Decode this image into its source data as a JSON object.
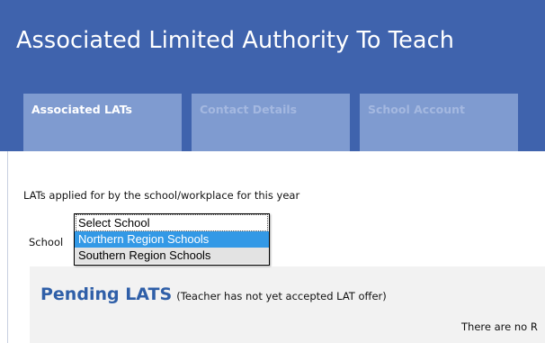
{
  "header": {
    "title": "Associated Limited Authority To Teach"
  },
  "tabs": [
    {
      "label": "Associated LATs"
    },
    {
      "label": "Contact Details"
    },
    {
      "label": "School Account"
    }
  ],
  "main": {
    "intro_text": "LATs applied for by the school/workplace for this year",
    "school_label": "School",
    "school_select": {
      "options": [
        "Select School",
        "Northern Region Schools",
        "Southern Region Schools"
      ],
      "highlighted": "Northern Region Schools",
      "selected": "Southern Region Schools"
    },
    "pending": {
      "title": "Pending LATS",
      "subtitle": "(Teacher has not yet accepted LAT offer)",
      "empty_message": "There are no R"
    }
  },
  "colors": {
    "header_bg": "#3f63ad",
    "tab_bg": "#7f9bd0",
    "heading_blue": "#2f5fa8",
    "highlight": "#3399e6"
  }
}
